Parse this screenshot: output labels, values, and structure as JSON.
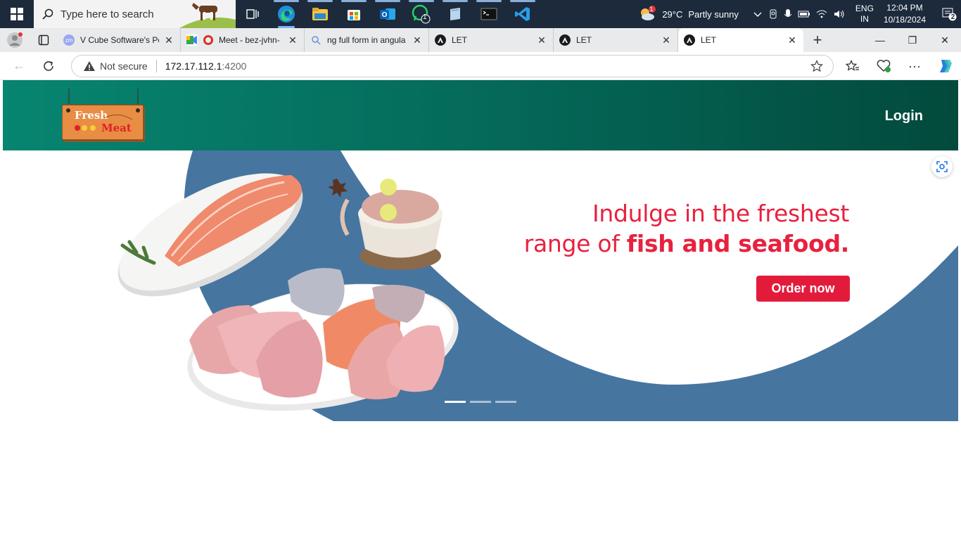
{
  "taskbar": {
    "search_placeholder": "Type here to search",
    "whatsapp_badge": "1",
    "weather": {
      "temp": "29°C",
      "condition": "Partly sunny",
      "alert_badge": "1"
    },
    "lang_line1": "ENG",
    "lang_line2": "IN",
    "time": "12:04 PM",
    "date": "10/18/2024",
    "notification_count": "2"
  },
  "browser": {
    "tabs": [
      {
        "title": "V Cube Software's Per",
        "favicon": "zm"
      },
      {
        "title": "Meet - bez-jvhn-"
      },
      {
        "title": "ng full form in angula"
      },
      {
        "title": "LET"
      },
      {
        "title": "LET"
      },
      {
        "title": "LET"
      }
    ],
    "security_label": "Not secure",
    "url_host": "172.17.112.1",
    "url_port": ":4200"
  },
  "site": {
    "logo_top": "Fresh",
    "logo_bottom": "Meat",
    "login_label": "Login",
    "headline_line1": "Indulge in the freshest",
    "headline_line2_pre": "range of ",
    "headline_line2_bold": "fish and seafood.",
    "order_button": "Order now",
    "colors": {
      "header_start": "#078570",
      "header_end": "#024a3c",
      "banner_blue": "#4675a0",
      "accent_red": "#e31b3b"
    }
  }
}
